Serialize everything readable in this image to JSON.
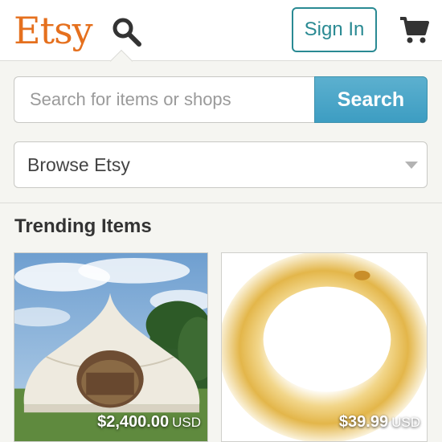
{
  "header": {
    "logo": "Etsy",
    "sign_in_label": "Sign In",
    "icons": {
      "search": "search-icon",
      "cart": "cart-icon"
    }
  },
  "search": {
    "placeholder": "Search for items or shops",
    "value": "",
    "button_label": "Search"
  },
  "browse": {
    "selected": "Browse Etsy"
  },
  "trending": {
    "title": "Trending Items",
    "items": [
      {
        "price": "$2,400.00",
        "currency": "USD"
      },
      {
        "price": "$39.99",
        "currency": "USD"
      }
    ]
  },
  "colors": {
    "brand_orange": "#e5701e",
    "teal": "#2a8a93",
    "search_blue": "#4aa6c9"
  }
}
